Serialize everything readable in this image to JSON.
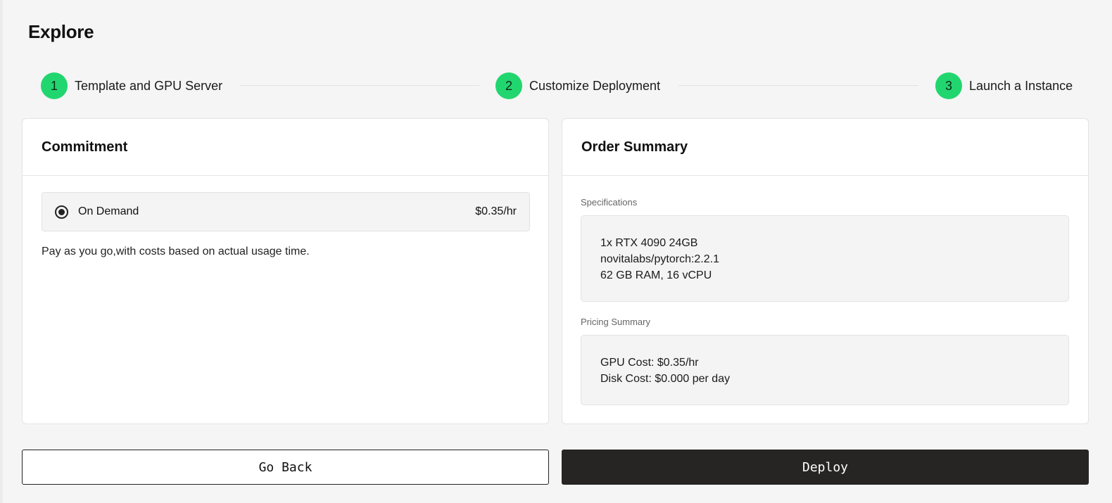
{
  "page": {
    "title": "Explore"
  },
  "stepper": {
    "steps": [
      {
        "number": "1",
        "label": "Template and GPU Server"
      },
      {
        "number": "2",
        "label": "Customize Deployment"
      },
      {
        "number": "3",
        "label": "Launch a Instance"
      }
    ],
    "accent_color": "#22d66f"
  },
  "commitment": {
    "title": "Commitment",
    "option": {
      "label": "On Demand",
      "price": "$0.35/hr",
      "selected": true
    },
    "description": "Pay as you go,with costs based on actual usage time."
  },
  "order_summary": {
    "title": "Order Summary",
    "specifications": {
      "label": "Specifications",
      "lines": [
        "1x RTX 4090 24GB",
        "novitalabs/pytorch:2.2.1",
        "62 GB RAM, 16 vCPU"
      ]
    },
    "pricing": {
      "label": "Pricing Summary",
      "lines": [
        "GPU Cost: $0.35/hr",
        "Disk Cost: $0.000 per day"
      ]
    }
  },
  "actions": {
    "back_label": "Go Back",
    "deploy_label": "Deploy",
    "deploy_color": "#262523"
  }
}
